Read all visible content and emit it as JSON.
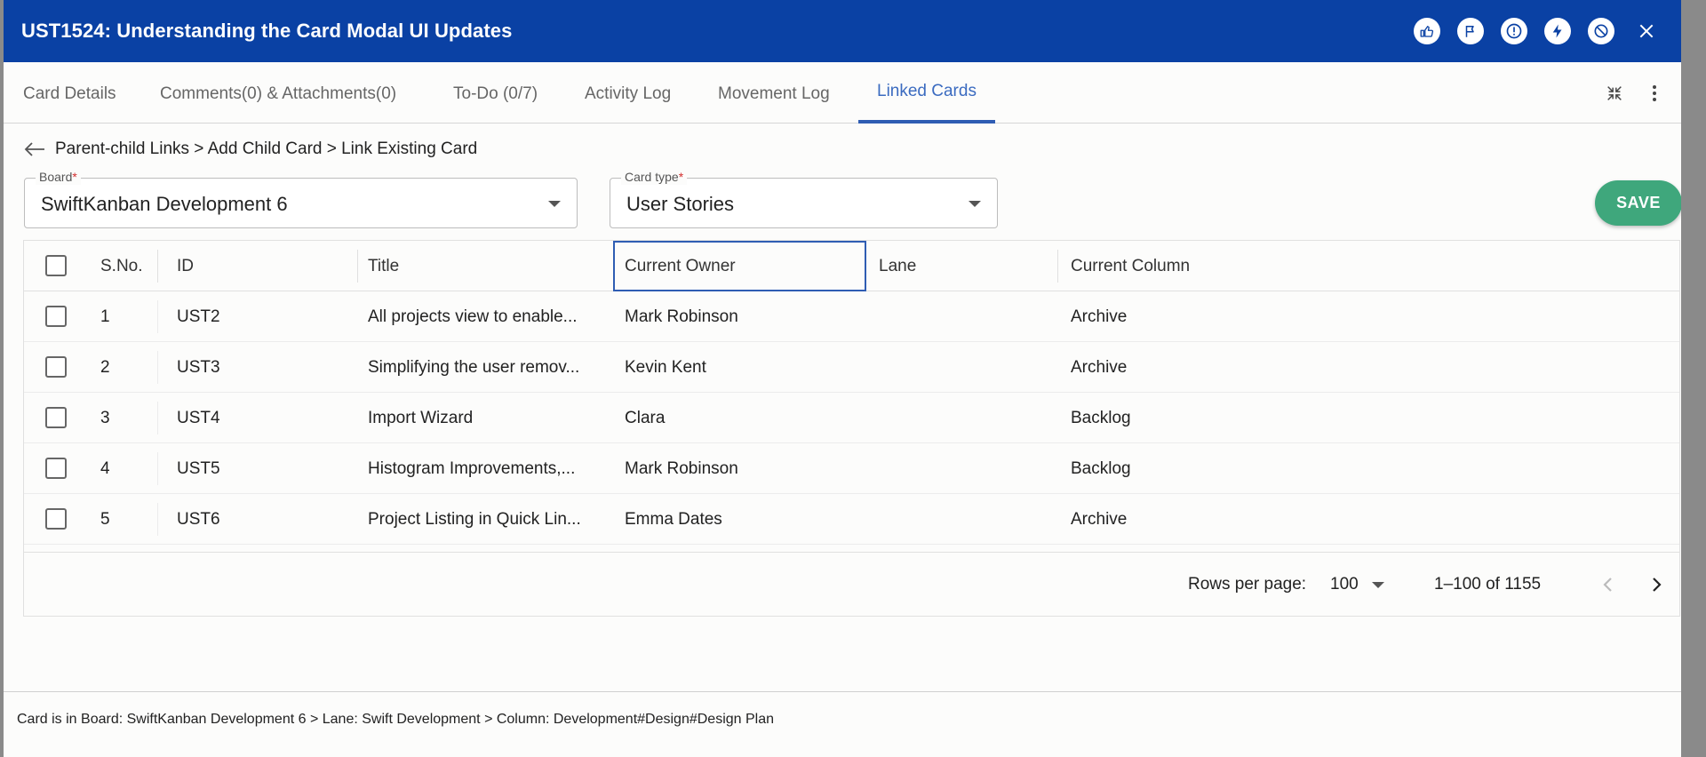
{
  "modal": {
    "title": "UST1524:  Understanding the Card Modal UI Updates",
    "title_icons": [
      "thumbs-up-icon",
      "flag-icon",
      "alert-icon",
      "lightning-icon",
      "block-icon",
      "close-icon"
    ]
  },
  "tabs": [
    {
      "label": "Card Details",
      "active": false
    },
    {
      "label": "Comments(0) & Attachments(0)",
      "active": false
    },
    {
      "label": "To-Do (0/7)",
      "active": false
    },
    {
      "label": "Activity Log",
      "active": false
    },
    {
      "label": "Movement Log",
      "active": false
    },
    {
      "label": "Linked Cards",
      "active": true
    }
  ],
  "tab_tools": [
    "collapse-icon",
    "more-vert-icon"
  ],
  "breadcrumb": "Parent-child Links > Add Child Card > Link Existing Card",
  "filters": {
    "board": {
      "label": "Board",
      "required_mark": "*",
      "value": "SwiftKanban Development 6"
    },
    "card_type": {
      "label": "Card type",
      "required_mark": "*",
      "value": "User Stories"
    }
  },
  "save_label": "SAVE",
  "table": {
    "columns": [
      "S.No.",
      "ID",
      "Title",
      "Current Owner",
      "Lane",
      "Current Column"
    ],
    "rows": [
      {
        "sno": "1",
        "id": "UST2",
        "title": "All projects view to enable...",
        "owner": "Mark Robinson",
        "lane": "",
        "column": "Archive"
      },
      {
        "sno": "2",
        "id": "UST3",
        "title": "Simplifying the user remov...",
        "owner": "Kevin Kent",
        "lane": "",
        "column": "Archive"
      },
      {
        "sno": "3",
        "id": "UST4",
        "title": "Import Wizard",
        "owner": "Clara",
        "lane": "",
        "column": "Backlog"
      },
      {
        "sno": "4",
        "id": "UST5",
        "title": "Histogram Improvements,...",
        "owner": "Mark Robinson",
        "lane": "",
        "column": "Backlog"
      },
      {
        "sno": "5",
        "id": "UST6",
        "title": "Project Listing in Quick Lin...",
        "owner": "Emma Dates",
        "lane": "",
        "column": "Archive"
      }
    ]
  },
  "pagination": {
    "rows_per_page_label": "Rows per page:",
    "rows_per_page": "100",
    "range": "1–100 of 1155"
  },
  "status_bar": "Card is in Board:  SwiftKanban Development 6   >   Lane:  Swift Development   >   Column:  Development#Design#Design Plan",
  "colors": {
    "header_blue": "#0a41a4",
    "accent": "#2f5db3",
    "save_green": "#3fa77c"
  }
}
